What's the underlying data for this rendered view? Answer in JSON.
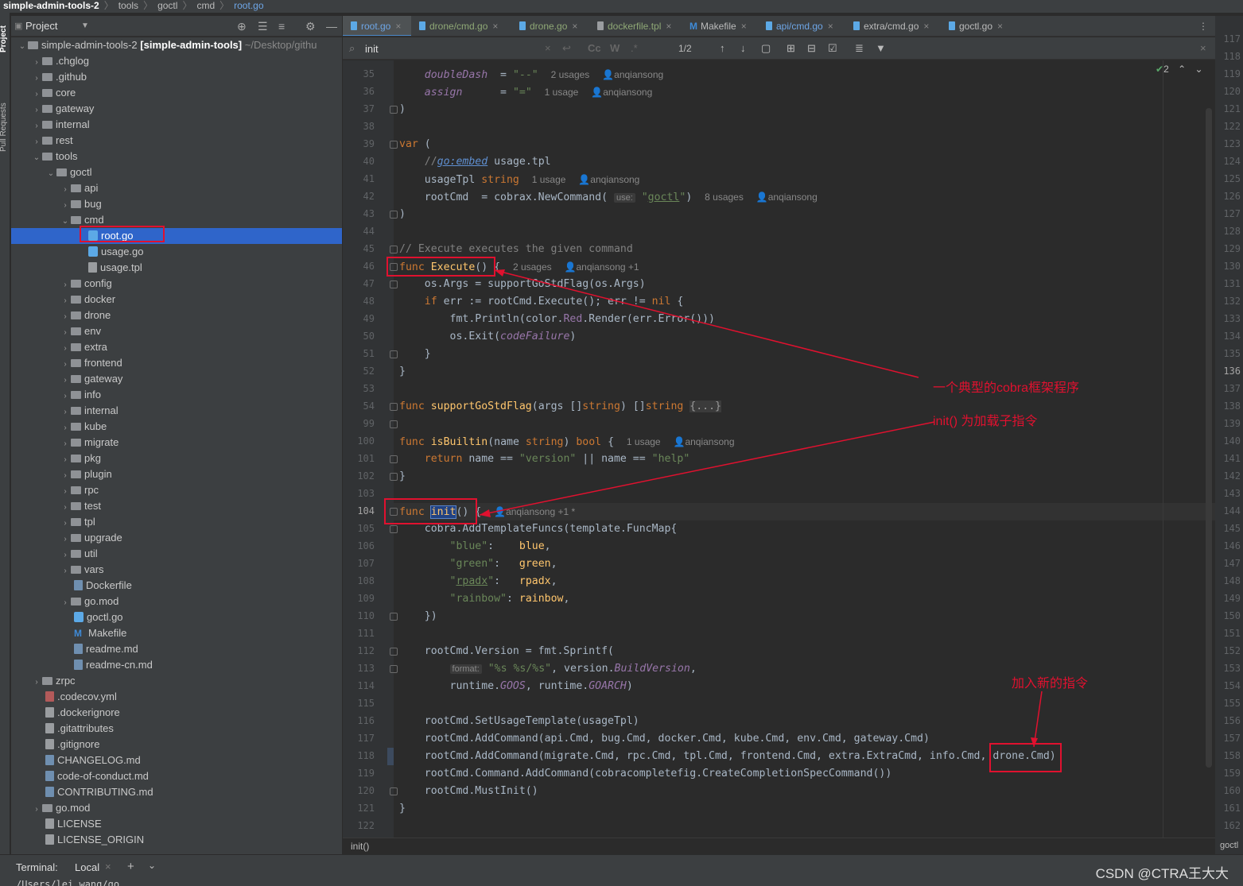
{
  "navbar": {
    "project": "simple-admin-tools-2",
    "p1": "tools",
    "p2": "goctl",
    "p3": "cmd",
    "file": "root.go"
  },
  "sidebar": {
    "project_tab": "Project",
    "pr_tab": "Pull Requests"
  },
  "project_panel": {
    "title": "Project",
    "root_name": "simple-admin-tools-2",
    "root_module": "[simple-admin-tools]",
    "root_path": "~/Desktop/githu"
  },
  "tree": [
    {
      "label": ".chglog"
    },
    {
      "label": ".github"
    },
    {
      "label": "core"
    },
    {
      "label": "gateway"
    },
    {
      "label": "internal"
    },
    {
      "label": "rest"
    },
    {
      "label": "tools"
    },
    {
      "label": "goctl"
    },
    {
      "label": "api"
    },
    {
      "label": "bug"
    },
    {
      "label": "cmd"
    },
    {
      "label": "root.go"
    },
    {
      "label": "usage.go"
    },
    {
      "label": "usage.tpl"
    },
    {
      "label": "config"
    },
    {
      "label": "docker"
    },
    {
      "label": "drone"
    },
    {
      "label": "env"
    },
    {
      "label": "extra"
    },
    {
      "label": "frontend"
    },
    {
      "label": "gateway"
    },
    {
      "label": "info"
    },
    {
      "label": "internal"
    },
    {
      "label": "kube"
    },
    {
      "label": "migrate"
    },
    {
      "label": "pkg"
    },
    {
      "label": "plugin"
    },
    {
      "label": "rpc"
    },
    {
      "label": "test"
    },
    {
      "label": "tpl"
    },
    {
      "label": "upgrade"
    },
    {
      "label": "util"
    },
    {
      "label": "vars"
    },
    {
      "label": "Dockerfile"
    },
    {
      "label": "go.mod"
    },
    {
      "label": "goctl.go"
    },
    {
      "label": "Makefile"
    },
    {
      "label": "readme.md"
    },
    {
      "label": "readme-cn.md"
    },
    {
      "label": "zrpc"
    },
    {
      "label": ".codecov.yml"
    },
    {
      "label": ".dockerignore"
    },
    {
      "label": ".gitattributes"
    },
    {
      "label": ".gitignore"
    },
    {
      "label": "CHANGELOG.md"
    },
    {
      "label": "code-of-conduct.md"
    },
    {
      "label": "CONTRIBUTING.md"
    },
    {
      "label": "go.mod"
    },
    {
      "label": "LICENSE"
    },
    {
      "label": "LICENSE_ORIGIN"
    }
  ],
  "tabs": [
    {
      "label": "root.go"
    },
    {
      "label": "drone/cmd.go"
    },
    {
      "label": "drone.go"
    },
    {
      "label": "dockerfile.tpl"
    },
    {
      "label": "Makefile"
    },
    {
      "label": "api/cmd.go"
    },
    {
      "label": "extra/cmd.go"
    },
    {
      "label": "goctl.go"
    }
  ],
  "search": {
    "value": "init",
    "cc": "Cc",
    "w": "W",
    "regex": ".*",
    "matches": "1/2"
  },
  "editor": {
    "line_numbers": [
      "35",
      "36",
      "37",
      "38",
      "39",
      "40",
      "41",
      "42",
      "43",
      "44",
      "45",
      "46",
      "47",
      "48",
      "49",
      "50",
      "51",
      "52",
      "53",
      "54",
      "99",
      "100",
      "101",
      "102",
      "103",
      "104",
      "105",
      "106",
      "107",
      "108",
      "109",
      "110",
      "111",
      "112",
      "113",
      "114",
      "115",
      "116",
      "117",
      "118",
      "119",
      "120",
      "121",
      "122"
    ],
    "problems": "2",
    "hints": {
      "h35": "2 usages",
      "a35": "anqiansong",
      "h36": "1 usage",
      "a36": "anqiansong",
      "h41": "1 usage",
      "a41": "anqiansong",
      "use": "use:",
      "h42": "8 usages",
      "a42": "anqiansong",
      "h46": "2 usages",
      "a46": "anqiansong +1",
      "h100": "1 usage",
      "a100": "anqiansong",
      "a104": "anqiansong +1 *",
      "format": "format:"
    }
  },
  "right_gutter": [
    "117",
    "118",
    "119",
    "120",
    "121",
    "122",
    "123",
    "124",
    "125",
    "126",
    "127",
    "128",
    "129",
    "130",
    "131",
    "132",
    "133",
    "134",
    "135",
    "136",
    "137",
    "138",
    "139",
    "140",
    "141",
    "142",
    "143",
    "144",
    "145",
    "146",
    "147",
    "148",
    "149",
    "150",
    "151",
    "152",
    "153",
    "154",
    "155",
    "156",
    "157",
    "158",
    "159",
    "160",
    "161",
    "162"
  ],
  "status": {
    "breadcrumb": "init()",
    "right": "goctl"
  },
  "terminal": {
    "label": "Terminal:",
    "tab": "Local",
    "path": "/Users/lei_wang/go"
  },
  "annotations": {
    "cobra": "一个典型的cobra框架程序",
    "init": "init() 为加载子指令",
    "newcmd": "加入新的指令"
  },
  "watermark": "CSDN @CTRA王大大",
  "colors": {
    "accent": "#2f65ca",
    "annotation": "#e0112f",
    "editor_bg": "#2b2b2b"
  }
}
